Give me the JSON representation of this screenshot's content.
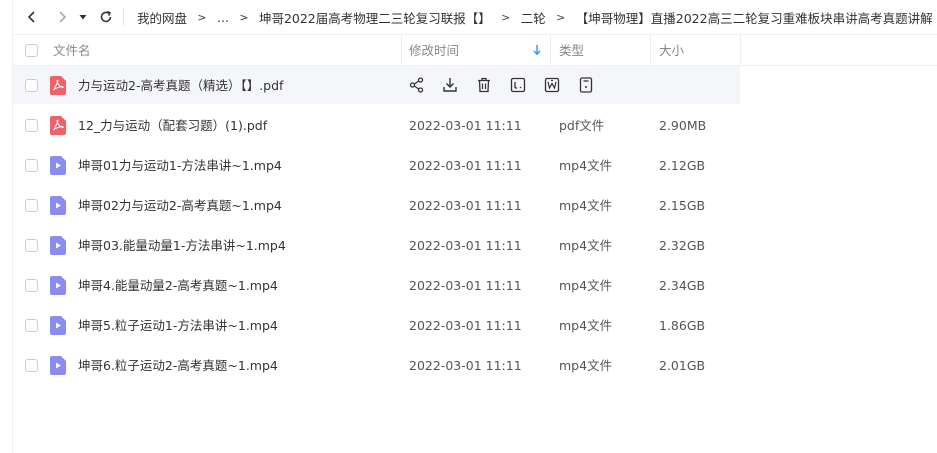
{
  "breadcrumb": {
    "items": [
      "我的网盘",
      "...",
      "坤哥2022届高考物理二三轮复习联报【】",
      "二轮",
      "【坤哥物理】直播2022高三二轮复习重难板块串讲高考真题讲解"
    ],
    "separator": ">"
  },
  "columns": {
    "name": "文件名",
    "modified": "修改时间",
    "type": "类型",
    "size": "大小"
  },
  "files": [
    {
      "name": "力与运动2-高考真题（精选）【】.pdf",
      "date": "",
      "type": "",
      "size": "",
      "icon": "pdf-icon"
    },
    {
      "name": "12_力与运动（配套习题）(1).pdf",
      "date": "2022-03-01 11:11",
      "type": "pdf文件",
      "size": "2.90MB",
      "icon": "pdf-icon"
    },
    {
      "name": "坤哥01力与运动1-方法串讲~1.mp4",
      "date": "2022-03-01 11:11",
      "type": "mp4文件",
      "size": "2.12GB",
      "icon": "video-icon"
    },
    {
      "name": "坤哥02力与运动2-高考真题~1.mp4",
      "date": "2022-03-01 11:11",
      "type": "mp4文件",
      "size": "2.15GB",
      "icon": "video-icon"
    },
    {
      "name": "坤哥03.能量动量1-方法串讲~1.mp4",
      "date": "2022-03-01 11:11",
      "type": "mp4文件",
      "size": "2.32GB",
      "icon": "video-icon"
    },
    {
      "name": "坤哥4.能量动量2-高考真题~1.mp4",
      "date": "2022-03-01 11:11",
      "type": "mp4文件",
      "size": "2.34GB",
      "icon": "video-icon"
    },
    {
      "name": "坤哥5.粒子运动1-方法串讲~1.mp4",
      "date": "2022-03-01 11:11",
      "type": "mp4文件",
      "size": "1.86GB",
      "icon": "video-icon"
    },
    {
      "name": "坤哥6.粒子运动2-高考真题~1.mp4",
      "date": "2022-03-01 11:11",
      "type": "mp4文件",
      "size": "2.01GB",
      "icon": "video-icon"
    }
  ],
  "row_actions": [
    "share-icon",
    "download-icon",
    "delete-icon",
    "text-extract-icon",
    "word-convert-icon",
    "more-icon"
  ],
  "colors": {
    "pdf": "#f0616a",
    "video": "#8a8cf0",
    "sort_accent": "#2b95f6",
    "hover_row": "#f5f6f9"
  }
}
